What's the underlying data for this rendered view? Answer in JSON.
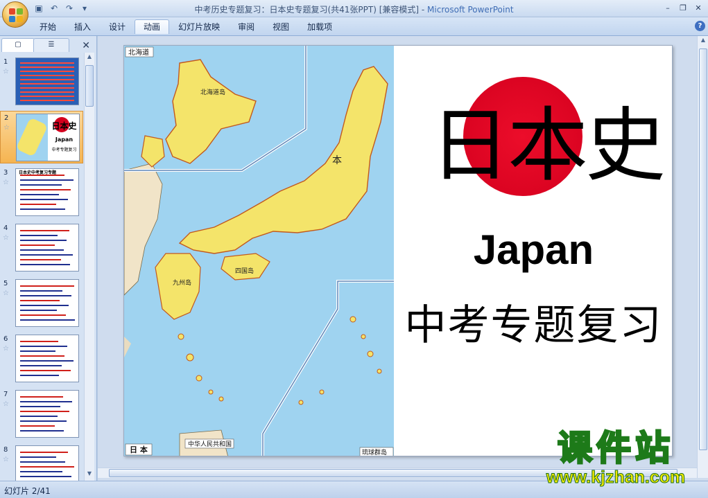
{
  "window": {
    "title": "中考历史专题复习：日本史专题复习(共41张PPT) [兼容模式]",
    "app_name": "Microsoft PowerPoint"
  },
  "qat": {
    "save": "save-icon",
    "undo": "undo-icon",
    "redo": "redo-icon",
    "more": "more-icon"
  },
  "ribbon": {
    "tabs": [
      {
        "label": "开始"
      },
      {
        "label": "插入"
      },
      {
        "label": "设计"
      },
      {
        "label": "动画",
        "active": true
      },
      {
        "label": "幻灯片放映"
      },
      {
        "label": "审阅"
      },
      {
        "label": "视图"
      },
      {
        "label": "加载项"
      }
    ],
    "help": "?"
  },
  "thumbnails": [
    {
      "num": "1",
      "star": "☆"
    },
    {
      "num": "2",
      "star": "☆",
      "selected": true,
      "title": "日本史",
      "subtitle": "Japan",
      "subtitle2": "中考专题复习"
    },
    {
      "num": "3",
      "star": "☆",
      "title": "日本史中考复习专题"
    },
    {
      "num": "4",
      "star": "☆"
    },
    {
      "num": "5",
      "star": "☆"
    },
    {
      "num": "6",
      "star": "☆"
    },
    {
      "num": "7",
      "star": "☆"
    },
    {
      "num": "8",
      "star": "☆"
    }
  ],
  "slide": {
    "title_cn": "日本史",
    "title_en": "Japan",
    "subtitle": "中考专题复习",
    "map_labels": {
      "hokkaido": "北海道",
      "japan": "日 本",
      "kyushu": "九州岛",
      "shikoku": "四国岛",
      "hokkaido_island": "北海道岛",
      "ryukyu": "琉球群岛",
      "china": "中华人民共和国",
      "honshu": "本"
    }
  },
  "status": {
    "slide_indicator": "幻灯片 2/41"
  },
  "watermark": {
    "line1": "课件站",
    "line2": "www.kjzhan.com"
  },
  "colors": {
    "sun": "#d4001e",
    "land": "#f4e46a",
    "sea": "#9fd3f0",
    "selected": "#f5b451"
  }
}
